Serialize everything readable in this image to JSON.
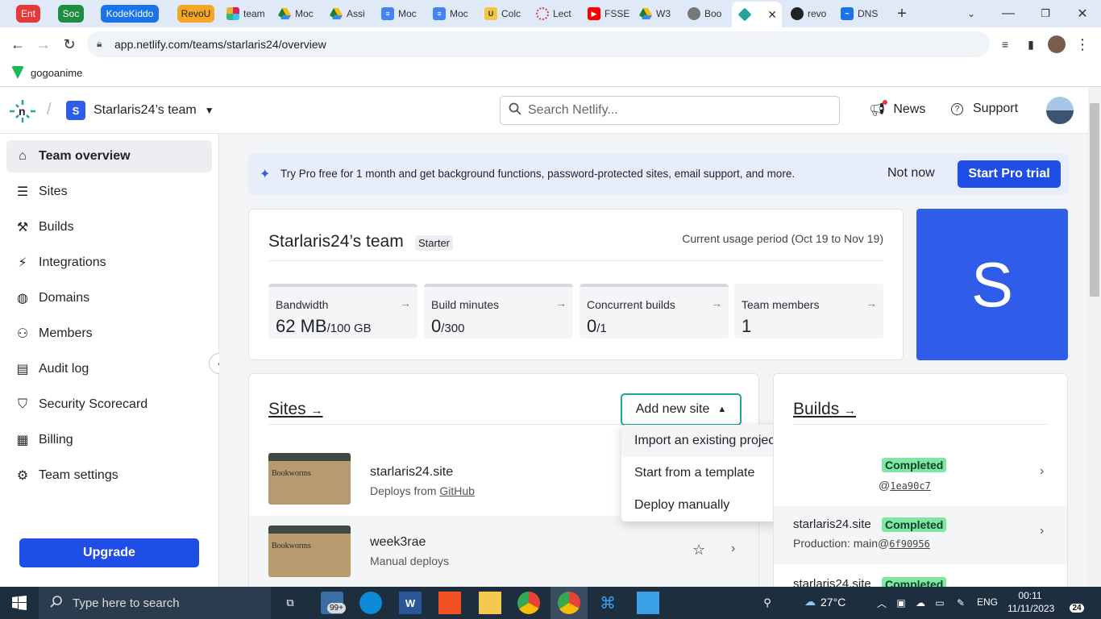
{
  "browser": {
    "tab_groups": [
      {
        "label": "Ent",
        "color": "#e43a3a"
      },
      {
        "label": "Soc",
        "color": "#1e8e3e"
      },
      {
        "label": "KodeKiddo",
        "color": "#1a73e8"
      },
      {
        "label": "RevoU",
        "color": "#f5a623"
      }
    ],
    "tabs": [
      {
        "label": "team",
        "icon": "slack-icon"
      },
      {
        "label": "Moc",
        "icon": "drive-icon"
      },
      {
        "label": "Assi",
        "icon": "drive-icon"
      },
      {
        "label": "Moc",
        "icon": "docs-icon"
      },
      {
        "label": "Moc",
        "icon": "docs-icon"
      },
      {
        "label": "Colc",
        "icon": "cup-icon"
      },
      {
        "label": "Lect",
        "icon": "circle-icon"
      },
      {
        "label": "FSSE",
        "icon": "youtube-icon"
      },
      {
        "label": "W3",
        "icon": "drive-icon"
      },
      {
        "label": "Boo",
        "icon": "globe-icon"
      },
      {
        "label": "",
        "icon": "netlify-icon"
      },
      {
        "label": "revo",
        "icon": "github-icon"
      },
      {
        "label": "DNS",
        "icon": "chart-icon"
      }
    ],
    "url": "app.netlify.com/teams/starlaris24/overview",
    "bookmark": "gogoanime"
  },
  "header": {
    "team_initial": "S",
    "team_name": "Starlaris24’s team",
    "search_placeholder": "Search Netlify...",
    "news_label": "News",
    "support_label": "Support"
  },
  "sidebar": {
    "items": [
      {
        "label": "Team overview",
        "icon": "home-icon"
      },
      {
        "label": "Sites",
        "icon": "stack-icon"
      },
      {
        "label": "Builds",
        "icon": "hammer-icon"
      },
      {
        "label": "Integrations",
        "icon": "plug-icon"
      },
      {
        "label": "Domains",
        "icon": "globe-icon"
      },
      {
        "label": "Members",
        "icon": "users-icon"
      },
      {
        "label": "Audit log",
        "icon": "log-icon"
      },
      {
        "label": "Security Scorecard",
        "icon": "shield-icon"
      },
      {
        "label": "Billing",
        "icon": "receipt-icon"
      },
      {
        "label": "Team settings",
        "icon": "gear-icon"
      }
    ],
    "upgrade_label": "Upgrade"
  },
  "promo": {
    "text": "Try Pro free for 1 month and get background functions, password-protected sites, email support, and more.",
    "dismiss_label": "Not now",
    "cta_label": "Start Pro trial"
  },
  "team_card": {
    "name": "Starlaris24’s team",
    "plan": "Starter",
    "usage_period": "Current usage period (Oct 19 to Nov 19)",
    "avatar_letter": "S",
    "stats": [
      {
        "label": "Bandwidth",
        "value": "62 MB",
        "limit": "/100 GB"
      },
      {
        "label": "Build minutes",
        "value": "0",
        "limit": "/300"
      },
      {
        "label": "Concurrent builds",
        "value": "0",
        "limit": "/1"
      },
      {
        "label": "Team members",
        "value": "1",
        "limit": ""
      }
    ]
  },
  "sites": {
    "title": "Sites",
    "add_label": "Add new site",
    "menu": [
      "Import an existing project",
      "Start from a template",
      "Deploy manually"
    ],
    "list": [
      {
        "name": "starlaris24.site",
        "sub": "Deploys from ",
        "sub_link": "GitHub"
      },
      {
        "name": "week3rae",
        "sub": "Manual deploys",
        "sub_link": ""
      }
    ],
    "thumb_text": "Bookworms"
  },
  "builds": {
    "title": "Builds",
    "list": [
      {
        "name": "",
        "status": "Completed",
        "branch": "@",
        "commit": "1ea90c7"
      },
      {
        "name": "starlaris24.site",
        "status": "Completed",
        "branch": "Production: main@",
        "commit": "6f90956"
      },
      {
        "name": "starlaris24.site",
        "status": "Completed",
        "branch": "",
        "commit": ""
      }
    ]
  },
  "taskbar": {
    "search_placeholder": "Type here to search",
    "mail_badge": "99+",
    "temperature": "27°C",
    "language": "ENG",
    "time": "00:11",
    "date": "11/11/2023",
    "notifications": "24"
  }
}
